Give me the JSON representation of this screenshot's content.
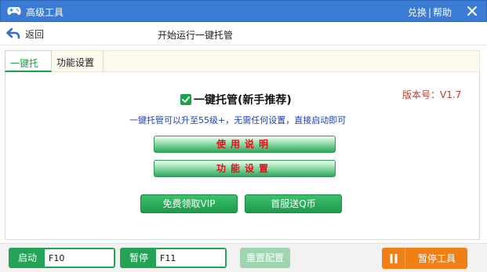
{
  "window": {
    "title": "高级工具",
    "links": [
      "兑换",
      "帮助"
    ],
    "link_separator": "|",
    "icon": "gamepad-icon",
    "close_icon": "close-icon"
  },
  "subbar": {
    "back_label": "返回",
    "back_icon": "back-arrow-icon",
    "heading": "开始运行一键托管"
  },
  "tabs": [
    {
      "label": "一键托管",
      "active": true
    },
    {
      "label": "功能设置",
      "active": false
    }
  ],
  "main": {
    "mode_label": "一键托管(新手推荐)",
    "mode_checked": true,
    "version": "版本号：V1.7",
    "description": "一键托管可以升至55级+，无需任何设置，直接启动即可",
    "guide_button": "使用说明",
    "settings_button": "功能设置",
    "vip_button": "免费领取VIP",
    "qcoin_button": "首服送Q币"
  },
  "bottom": {
    "start_label": "启动",
    "start_key": "F10",
    "pause_label": "暂停",
    "pause_key": "F11",
    "reset_button": "重置配置",
    "pause_tool_button": "暂停工具",
    "pause_tool_icon": "pause-icon"
  },
  "colors": {
    "titlebar": "#3a7bd5",
    "accent_green": "#24a256",
    "orange": "#f07f14",
    "red_text": "#e0101a",
    "version_red": "#c0392b",
    "desc_blue": "#1a3fb5"
  }
}
